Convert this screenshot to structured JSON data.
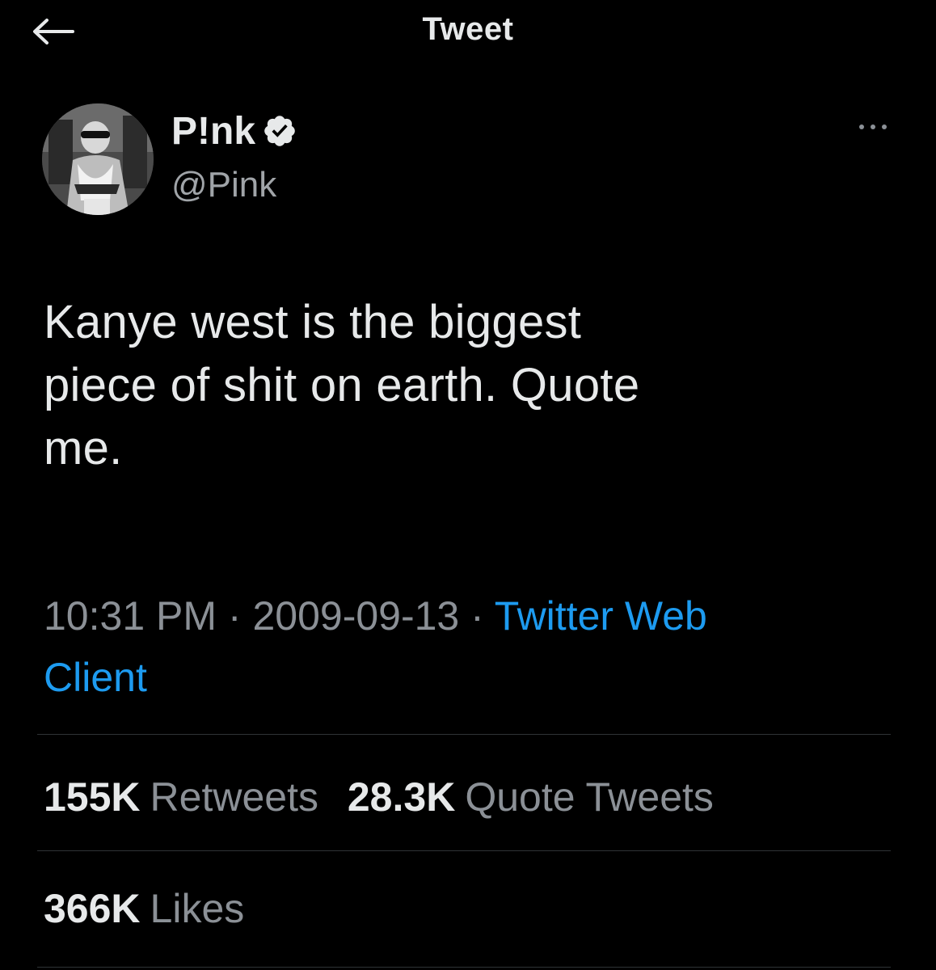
{
  "header": {
    "title": "Tweet",
    "back_icon": "arrow-left-icon"
  },
  "author": {
    "display_name": "P!nk",
    "handle": "@Pink",
    "verified": true,
    "verified_icon": "verified-badge-icon",
    "more_icon": "more-horizontal-icon"
  },
  "tweet": {
    "lines": [
      "Kanye west is the biggest",
      "piece of shit on earth. Quote",
      "me."
    ],
    "time": "10:31 PM",
    "date": "2009-09-13",
    "separator": "·",
    "source_line1": "Twitter Web",
    "source_line2": "Client"
  },
  "stats": {
    "retweets_count": "155K",
    "retweets_label": "Retweets",
    "quotes_count": "28.3K",
    "quotes_label": "Quote Tweets",
    "likes_count": "366K",
    "likes_label": "Likes"
  },
  "colors": {
    "background": "#000000",
    "text": "#e7e9ea",
    "secondary": "#8b9096",
    "link": "#1d9bf0",
    "divider": "#2f3336"
  }
}
